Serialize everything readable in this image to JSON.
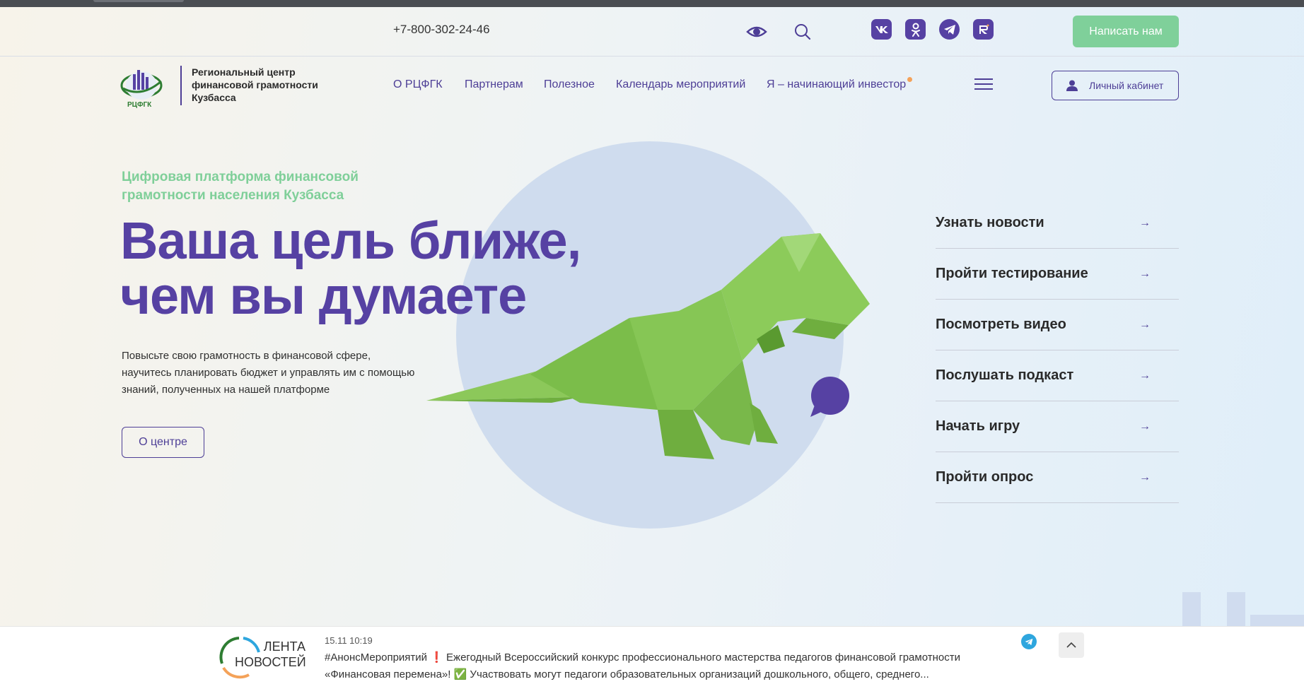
{
  "topbar": {
    "phone": "+7-800-302-24-46",
    "icons": [
      "eye-icon",
      "search-icon"
    ],
    "socials": [
      "vk-icon",
      "odnoklassniki-icon",
      "telegram-icon",
      "rutube-icon"
    ],
    "write_button": "Написать нам"
  },
  "navbar": {
    "logo_caption": "РЦФГК",
    "logo_text": "Региональный центр финансовой грамотности Кузбасса",
    "links": [
      "О РЦФГК",
      "Партнерам",
      "Полезное",
      "Календарь мероприятий",
      "Я – начинающий инвестор"
    ],
    "cabinet_label": "Личный кабинет"
  },
  "hero": {
    "subtitle": "Цифровая платформа финансовой грамотности населения Кузбасса",
    "headline_line1": "Ваша цель ближе,",
    "headline_line2": "чем вы думаете",
    "description": "Повысьте свою грамотность в финансовой сфере, научитесь планировать бюджет и управлять им с помощью знаний, полученных на нашей платформе",
    "about_button": "О центре"
  },
  "quick_links": [
    {
      "label": "Узнать новости",
      "arrow": "→"
    },
    {
      "label": "Пройти тестирование",
      "arrow": "→"
    },
    {
      "label": "Посмотреть видео",
      "arrow": "→"
    },
    {
      "label": "Послушать подкаст",
      "arrow": "→"
    },
    {
      "label": "Начать игру",
      "arrow": "→"
    },
    {
      "label": "Пройти опрос",
      "arrow": "→"
    }
  ],
  "ticker": {
    "logo_line1": "ЛЕНТА",
    "logo_line2": "НОВОСТЕЙ",
    "time": "15.11  10:19",
    "text": "#АнонсМероприятий ❗ Ежегодный Всероссийский конкурс профессионального мастерства педагогов финансовой грамотности «Финансовая перемена»! ✅ Участвовать могут педагоги образовательных организаций дошкольного, общего, среднего..."
  },
  "colors": {
    "primary": "#5641a3",
    "accent_green": "#7fd09a",
    "circle": "#cfdcee",
    "dino_green": "#7bbd4a"
  }
}
